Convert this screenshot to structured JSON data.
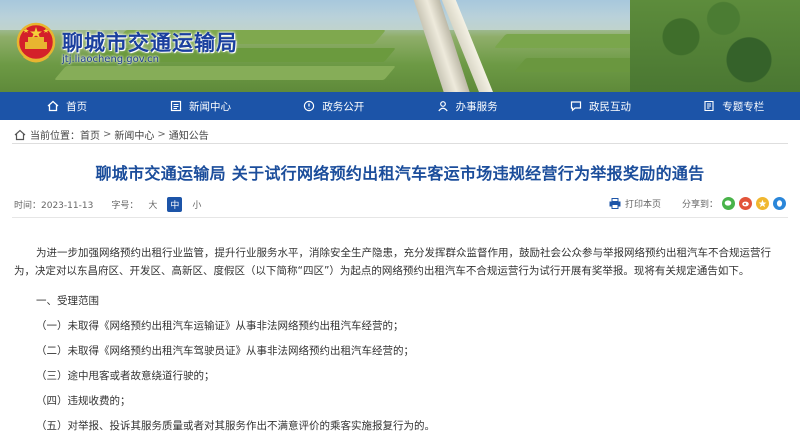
{
  "site": {
    "name": "聊城市交通运输局",
    "url": "jtj.liaocheng.gov.cn"
  },
  "nav": [
    {
      "label": "首页",
      "icon": "home-icon"
    },
    {
      "label": "新闻中心",
      "icon": "news-icon"
    },
    {
      "label": "政务公开",
      "icon": "gov-info-icon"
    },
    {
      "label": "办事服务",
      "icon": "service-icon"
    },
    {
      "label": "政民互动",
      "icon": "interaction-icon"
    },
    {
      "label": "专题专栏",
      "icon": "topics-icon"
    }
  ],
  "breadcrumb": {
    "prefix": "当前位置：",
    "items": [
      "首页",
      "新闻中心",
      "通知公告"
    ]
  },
  "article": {
    "title": "聊城市交通运输局 关于试行网络预约出租汽车客运市场违规经营行为举报奖励的通告",
    "date_label": "时间：2023-11-13",
    "font_size_label": "字号：",
    "font_sizes": [
      "大",
      "中",
      "小"
    ],
    "print_label": "打印本页",
    "share_label": "分享到：",
    "paragraphs": [
      "为进一步加强网络预约出租行业监管，提升行业服务水平，消除安全生产隐患，充分发挥群众监督作用，鼓励社会公众参与举报网络预约出租汽车不合规运营行为，决定对以东昌府区、开发区、高新区、度假区（以下简称“四区”）为起点的网络预约出租汽车不合规运营行为试行开展有奖举报。现将有关规定通告如下。"
    ],
    "section_heading": "一、受理范围",
    "items": [
      "（一）未取得《网络预约出租汽车运输证》从事非法网络预约出租汽车经营的；",
      "（二）未取得《网络预约出租汽车驾驶员证》从事非法网络预约出租汽车经营的；",
      "（三）途中甩客或者故意绕道行驶的；",
      "（四）违规收费的；",
      "（五）对举报、投诉其服务质量或者对其服务作出不满意评价的乘客实施报复行为的。"
    ]
  },
  "colors": {
    "nav_bg": "#1c54a8",
    "title": "#1b4d9b",
    "site_name": "#1a3f9e"
  }
}
